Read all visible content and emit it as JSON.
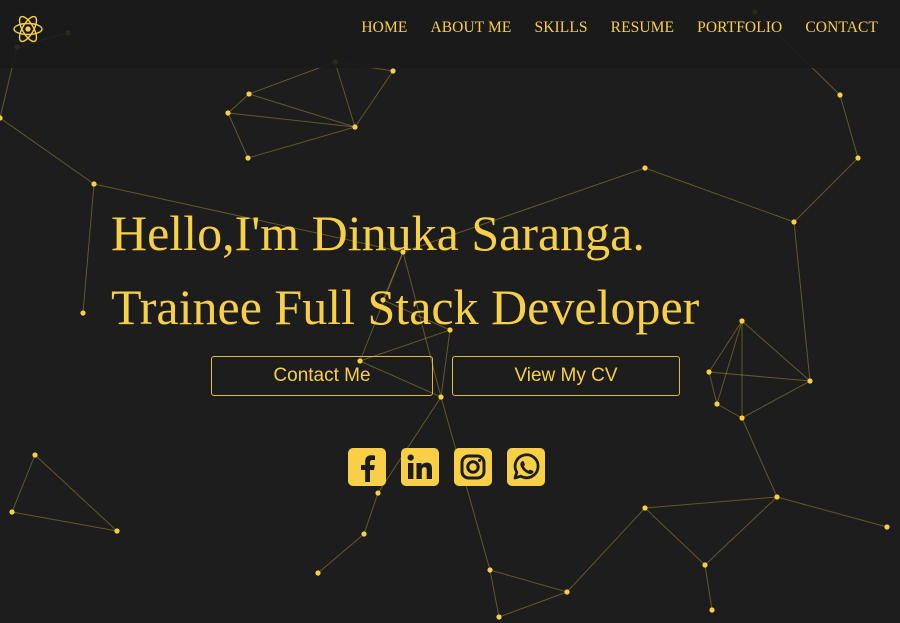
{
  "nav": {
    "items": [
      {
        "label": "HOME"
      },
      {
        "label": "ABOUT ME"
      },
      {
        "label": "SKILLS"
      },
      {
        "label": "RESUME"
      },
      {
        "label": "PORTFOLIO"
      },
      {
        "label": "CONTACT"
      }
    ]
  },
  "hero": {
    "greeting": "Hello,I'm Dinuka Saranga.",
    "role": "Trainee Full Stack Developer"
  },
  "buttons": {
    "contact_label": "Contact Me",
    "cv_label": "View My CV"
  },
  "socials": [
    {
      "icon": "facebook-icon"
    },
    {
      "icon": "linkedin-icon"
    },
    {
      "icon": "instagram-icon"
    },
    {
      "icon": "whatsapp-icon"
    }
  ],
  "theme": {
    "accent": "#f7d047",
    "background": "#1d1d1d"
  }
}
